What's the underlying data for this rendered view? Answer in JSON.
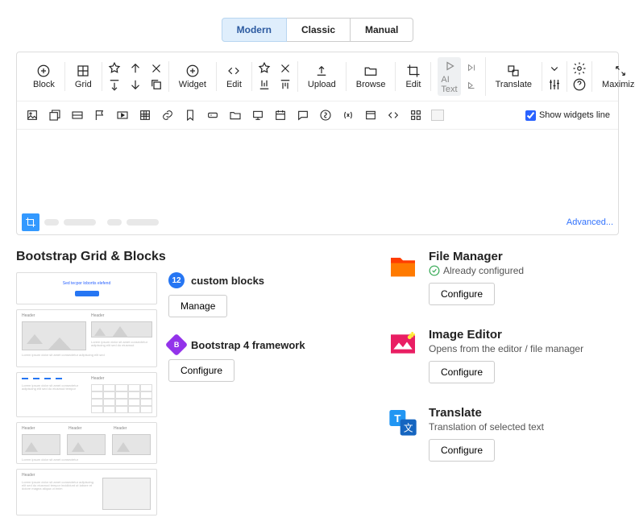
{
  "tabs": {
    "modern": "Modern",
    "classic": "Classic",
    "manual": "Manual"
  },
  "toolbar": {
    "block": "Block",
    "grid": "Grid",
    "widget": "Widget",
    "edit": "Edit",
    "upload": "Upload",
    "browse": "Browse",
    "edit2": "Edit",
    "aitext": "AI Text",
    "translate": "Translate",
    "maximize": "Maximize"
  },
  "show_widgets_line": "Show widgets line",
  "advanced": "Advanced...",
  "section_title": "Bootstrap Grid & Blocks",
  "custom_blocks": {
    "count": "12",
    "label": "custom blocks",
    "manage": "Manage"
  },
  "bootstrap": {
    "label": "Bootstrap 4 framework",
    "configure": "Configure"
  },
  "file_manager": {
    "title": "File Manager",
    "sub": "Already configured",
    "btn": "Configure"
  },
  "image_editor": {
    "title": "Image Editor",
    "sub": "Opens from the editor / file manager",
    "btn": "Configure"
  },
  "translate_feature": {
    "title": "Translate",
    "sub": "Translation of selected text",
    "btn": "Configure"
  },
  "thumbs": {
    "t1_title": "Sed tecpor lobortis elefend",
    "header": "Header"
  }
}
